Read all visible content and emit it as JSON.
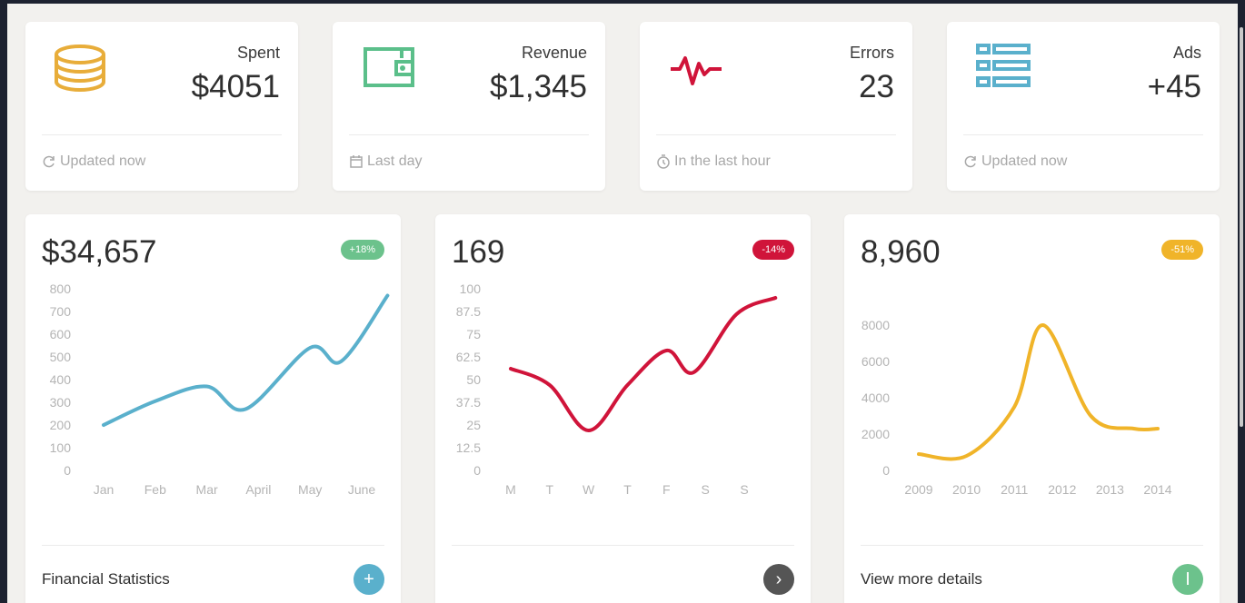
{
  "stats": [
    {
      "label": "Spent",
      "value": "$4051",
      "footer": "Updated now",
      "icon": "database-icon",
      "footer_icon": "refresh-icon",
      "color": "#e8ad3a"
    },
    {
      "label": "Revenue",
      "value": "$1,345",
      "footer": "Last day",
      "icon": "wallet-icon",
      "footer_icon": "calendar-icon",
      "color": "#5bbf8a"
    },
    {
      "label": "Errors",
      "value": "23",
      "footer": "In the last hour",
      "icon": "pulse-icon",
      "footer_icon": "clock-icon",
      "color": "#d0143a"
    },
    {
      "label": "Ads",
      "value": "+45",
      "footer": "Updated now",
      "icon": "list-icon",
      "footer_icon": "refresh-icon",
      "color": "#5ab0cc"
    }
  ],
  "charts": [
    {
      "big": "$34,657",
      "badge": "+18%",
      "badge_color": "#6cc28c",
      "footer_text": "Financial Statistics",
      "button_icon": "plus-icon",
      "button_glyph": "+",
      "button_color": "#5ab0cc"
    },
    {
      "big": "169",
      "badge": "-14%",
      "badge_color": "#d0143a",
      "footer_text": "",
      "button_icon": "arrow-right-icon",
      "button_glyph": "›",
      "button_color": "#555555"
    },
    {
      "big": "8,960",
      "badge": "-51%",
      "badge_color": "#f0b429",
      "footer_text": "View more details",
      "button_icon": "info-icon",
      "button_glyph": "I",
      "button_color": "#6cc28c"
    }
  ],
  "chart_data": [
    {
      "type": "line",
      "categories": [
        "Jan",
        "Feb",
        "Mar",
        "April",
        "May",
        "June"
      ],
      "series": [
        {
          "values": [
            200,
            305,
            370,
            270,
            540,
            480,
            770
          ]
        }
      ],
      "x_points": [
        0,
        1,
        2,
        2.75,
        4,
        4.6,
        5.5
      ],
      "yticks": [
        "0",
        "100",
        "200",
        "300",
        "400",
        "500",
        "600",
        "700",
        "800"
      ],
      "ylim": [
        0,
        800
      ],
      "color": "#5ab0cc"
    },
    {
      "type": "line",
      "categories": [
        "M",
        "T",
        "W",
        "T",
        "F",
        "S",
        "S"
      ],
      "series": [
        {
          "values": [
            56,
            47,
            22,
            47,
            66,
            54,
            86,
            95
          ]
        }
      ],
      "x_points": [
        0,
        1,
        2,
        3,
        4,
        4.7,
        5.8,
        6.8
      ],
      "yticks": [
        "0",
        "12.5",
        "25",
        "37.5",
        "50",
        "62.5",
        "75",
        "87.5",
        "100"
      ],
      "ylim": [
        0,
        100
      ],
      "color": "#d0143a"
    },
    {
      "type": "line",
      "categories": [
        "2009",
        "2010",
        "2011",
        "2012",
        "2013",
        "2014"
      ],
      "series": [
        {
          "values": [
            900,
            800,
            3500,
            8000,
            3000,
            2300,
            2300
          ]
        }
      ],
      "x_points": [
        2009,
        2010,
        2011,
        2011.6,
        2012.6,
        2013.5,
        2014
      ],
      "yticks": [
        "0",
        "2000",
        "4000",
        "6000",
        "8000"
      ],
      "ylim": [
        0,
        9000
      ],
      "color": "#f0b429"
    }
  ]
}
